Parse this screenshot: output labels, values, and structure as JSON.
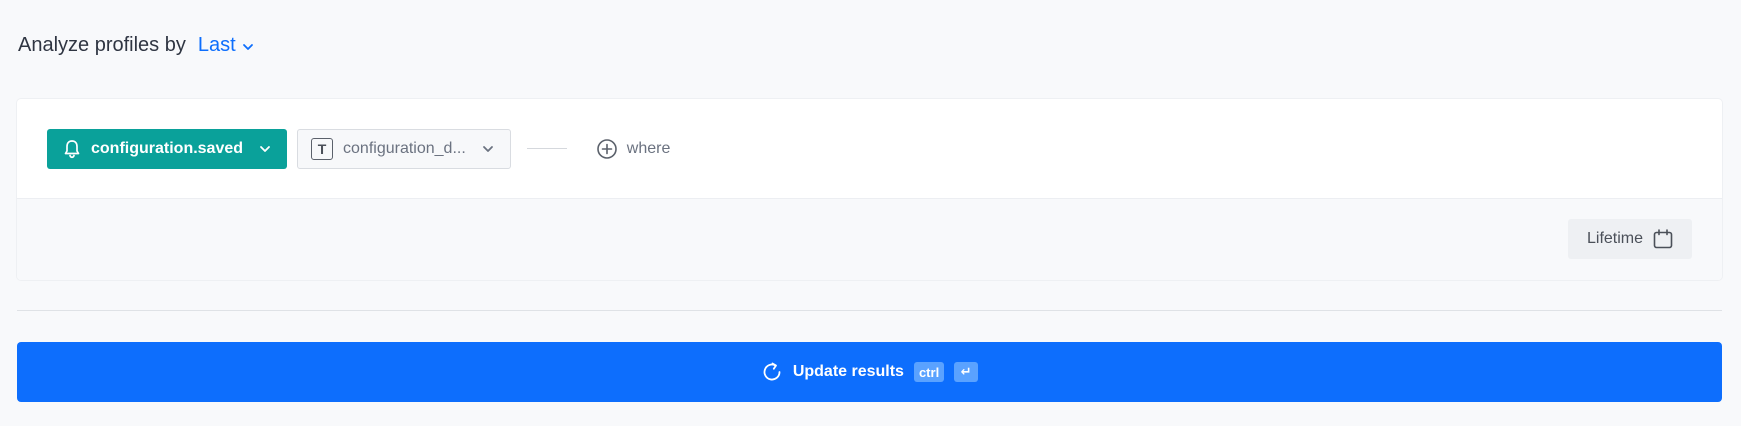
{
  "header": {
    "prefix": "Analyze profiles by",
    "mode": "Last"
  },
  "query": {
    "event": "configuration.saved",
    "property": "configuration_d...",
    "property_type_glyph": "T",
    "where_label": "where"
  },
  "date_range": {
    "label": "Lifetime"
  },
  "update": {
    "label": "Update results",
    "shortcut_modifier": "ctrl",
    "shortcut_key": "↵"
  },
  "colors": {
    "event_pill": "#0aa19a",
    "primary": "#0d6efd",
    "background": "#f8f9fb"
  },
  "icons": {
    "mode_dropdown": "chevron-down-icon",
    "event": "bell-icon",
    "event_dropdown": "chevron-down-icon",
    "property_type": "text-type-icon",
    "property_dropdown": "chevron-down-icon",
    "where": "plus-circle-icon",
    "date_range": "calendar-icon",
    "update": "refresh-icon"
  }
}
